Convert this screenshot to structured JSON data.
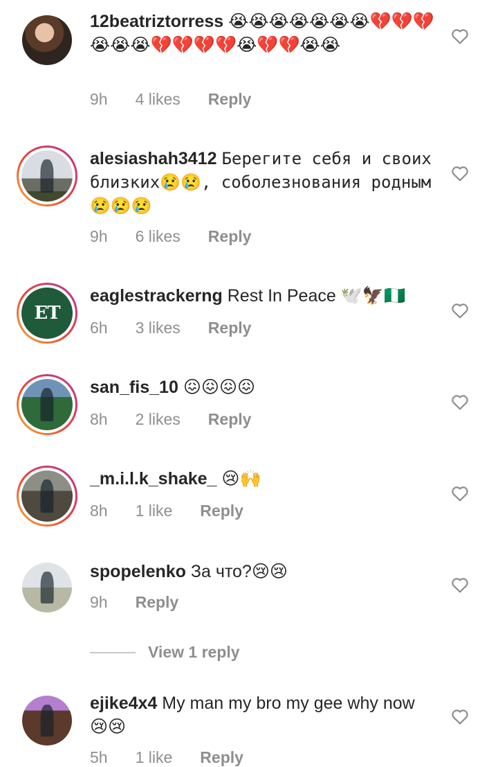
{
  "comments": [
    {
      "username": "12beatriztorress",
      "text": "😭😭😭😭😭😭😭💔💔💔😭😭😭💔💔💔💔😭💔💔😭😭",
      "time": "9h",
      "likes": "4 likes",
      "reply": "Reply"
    },
    {
      "username": "alesiashah3412",
      "text": "Берегите себя и своих близких😢😢, соболезнования родным😢😢😢",
      "time": "9h",
      "likes": "6 likes",
      "reply": "Reply"
    },
    {
      "username": "eaglestrackerng",
      "text": "Rest In Peace 🕊️🦅🇳🇬",
      "time": "6h",
      "likes": "3 likes",
      "reply": "Reply"
    },
    {
      "username": "san_fis_10",
      "text": "😖😖😖😖",
      "time": "8h",
      "likes": "2 likes",
      "reply": "Reply"
    },
    {
      "username": "_m.i.l.k_shake_",
      "text": "😢🙌",
      "time": "8h",
      "likes": "1 like",
      "reply": "Reply"
    },
    {
      "username": "spopelenko",
      "text": "За что?😢😢",
      "time": "9h",
      "likes": "",
      "reply": "Reply"
    },
    {
      "username": "ejike4x4",
      "text": "My man my bro my gee why now 😢😢",
      "time": "5h",
      "likes": "1 like",
      "reply": "Reply"
    }
  ],
  "view_replies": "View 1 reply",
  "avatar_logo_text": "ET",
  "colors": {
    "text": "#262626",
    "meta": "#8e8e8e",
    "ring_start": "#f9b233",
    "ring_end": "#c13584"
  },
  "icons": {
    "like": "heart-outline-icon"
  }
}
